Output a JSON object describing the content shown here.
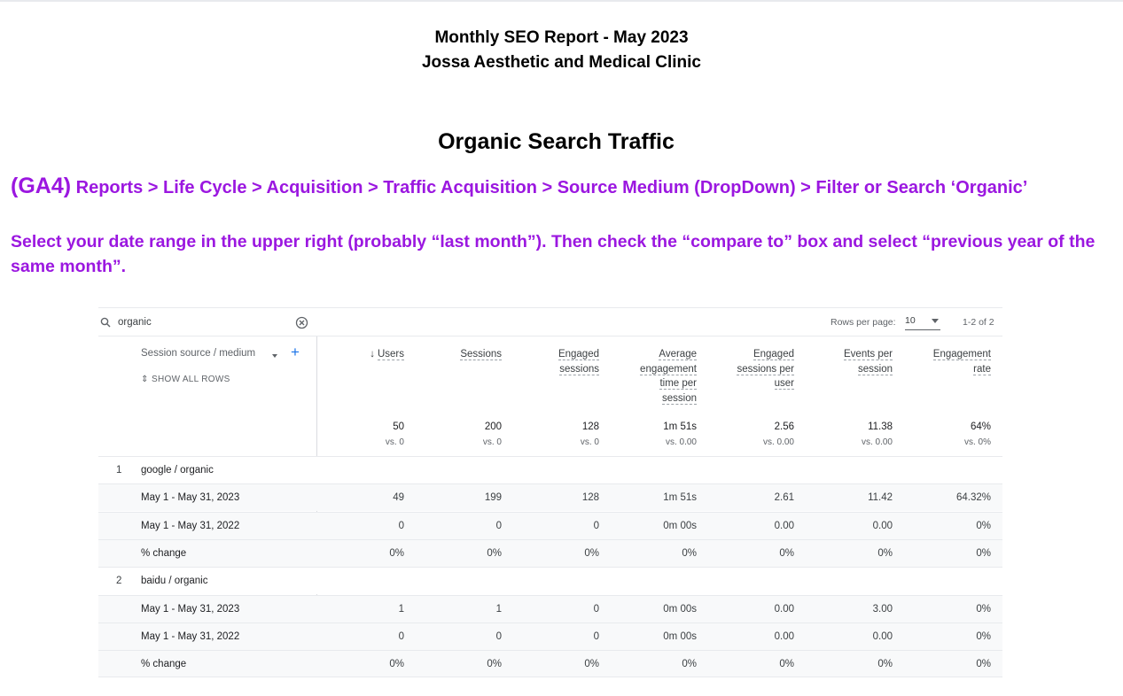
{
  "header": {
    "title_line1": "Monthly SEO Report - May 2023",
    "title_line2": "Jossa Aesthetic and Medical Clinic"
  },
  "section": {
    "title": "Organic Search Traffic",
    "path_tag": "(GA4)",
    "path_text": "Reports > Life Cycle > Acquisition > Traffic Acquisition > Source Medium (DropDown) > Filter or Search ‘Organic’",
    "instructions": "Select your date range in the upper right (probably “last month”). Then check the “compare to” box and select “previous year of the same month”."
  },
  "colors": {
    "accent_purple": "#9b17e0",
    "ga_blue": "#1a73e8"
  },
  "report": {
    "search_value": "organic",
    "rows_per_page_label": "Rows per page:",
    "rows_per_page_value": "10",
    "pagination": "1-2 of 2",
    "dimension_label": "Session source / medium",
    "show_all_rows": "SHOW ALL ROWS",
    "columns": [
      {
        "label": "Users",
        "sorted": true
      },
      {
        "label": "Sessions"
      },
      {
        "label": "Engaged sessions"
      },
      {
        "label": "Average engagement time per session"
      },
      {
        "label": "Engaged sessions per user"
      },
      {
        "label": "Events per session"
      },
      {
        "label": "Engagement rate"
      }
    ],
    "col_lines": [
      [
        "Users"
      ],
      [
        "Sessions"
      ],
      [
        "Engaged",
        "sessions"
      ],
      [
        "Average",
        "engagement",
        "time per",
        "session"
      ],
      [
        "Engaged",
        "sessions per",
        "user"
      ],
      [
        "Events per",
        "session"
      ],
      [
        "Engagement",
        "rate"
      ]
    ],
    "totals": [
      "50",
      "200",
      "128",
      "1m 51s",
      "2.56",
      "11.38",
      "64%"
    ],
    "totals_vs": [
      "vs. 0",
      "vs. 0",
      "vs. 0",
      "vs. 0.00",
      "vs. 0.00",
      "vs. 0.00",
      "vs. 0%"
    ],
    "rows": [
      {
        "type": "group",
        "num": "1",
        "label": "google / organic"
      },
      {
        "type": "data",
        "label": "May 1 - May 31, 2023",
        "values": [
          "49",
          "199",
          "128",
          "1m 51s",
          "2.61",
          "11.42",
          "64.32%"
        ]
      },
      {
        "type": "data",
        "label": "May 1 - May 31, 2022",
        "values": [
          "0",
          "0",
          "0",
          "0m 00s",
          "0.00",
          "0.00",
          "0%"
        ]
      },
      {
        "type": "data",
        "label": "% change",
        "values": [
          "0%",
          "0%",
          "0%",
          "0%",
          "0%",
          "0%",
          "0%"
        ]
      },
      {
        "type": "group",
        "num": "2",
        "label": "baidu / organic"
      },
      {
        "type": "data",
        "label": "May 1 - May 31, 2023",
        "values": [
          "1",
          "1",
          "0",
          "0m 00s",
          "0.00",
          "3.00",
          "0%"
        ]
      },
      {
        "type": "data",
        "label": "May 1 - May 31, 2022",
        "values": [
          "0",
          "0",
          "0",
          "0m 00s",
          "0.00",
          "0.00",
          "0%"
        ]
      },
      {
        "type": "data",
        "label": "% change",
        "values": [
          "0%",
          "0%",
          "0%",
          "0%",
          "0%",
          "0%",
          "0%"
        ]
      }
    ]
  }
}
